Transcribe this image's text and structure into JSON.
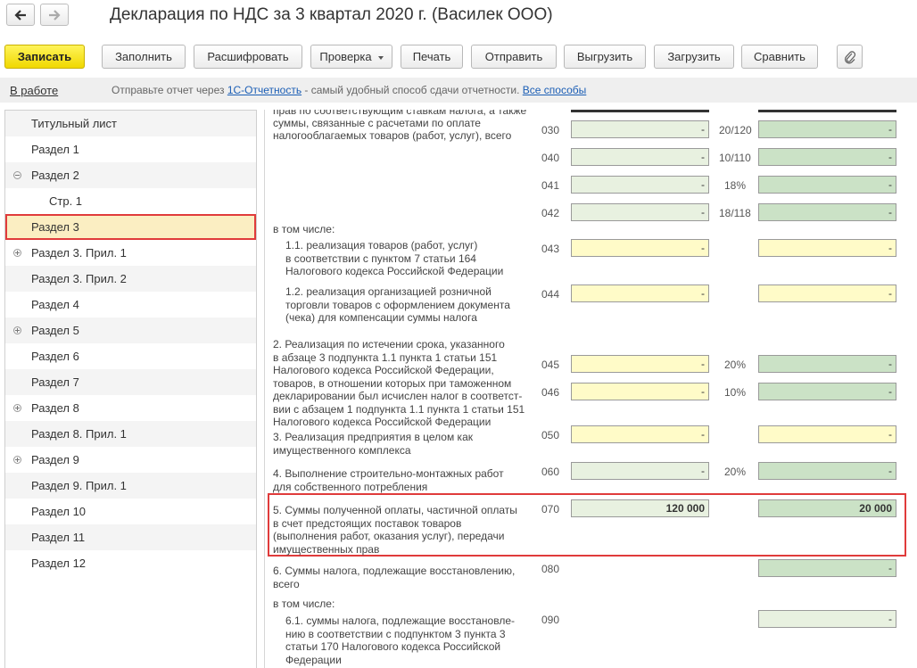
{
  "window": {
    "title": "Декларация по НДС за 3 квартал 2020 г. (Василек ООО)"
  },
  "toolbar": {
    "save": "Записать",
    "fill": "Заполнить",
    "decode": "Расшифровать",
    "check": "Проверка",
    "print": "Печать",
    "send": "Отправить",
    "export": "Выгрузить",
    "import": "Загрузить",
    "compare": "Сравнить"
  },
  "status": {
    "state": "В работе",
    "msg_prefix": "Отправьте отчет через ",
    "msg_link": "1С-Отчетность",
    "msg_middle": " - самый удобный способ сдачи отчетности. ",
    "msg_link2": "Все способы"
  },
  "sidebar": {
    "items": [
      {
        "label": "Титульный лист"
      },
      {
        "label": "Раздел 1"
      },
      {
        "label": "Раздел 2"
      },
      {
        "label": "Стр. 1"
      },
      {
        "label": "Раздел 3"
      },
      {
        "label": "Раздел 3. Прил. 1"
      },
      {
        "label": "Раздел 3. Прил. 2"
      },
      {
        "label": "Раздел 4"
      },
      {
        "label": "Раздел 5"
      },
      {
        "label": "Раздел 6"
      },
      {
        "label": "Раздел 7"
      },
      {
        "label": "Раздел 8"
      },
      {
        "label": "Раздел 8. Прил. 1"
      },
      {
        "label": "Раздел 9"
      },
      {
        "label": "Раздел 9. Прил. 1"
      },
      {
        "label": "Раздел 10"
      },
      {
        "label": "Раздел 11"
      },
      {
        "label": "Раздел 12"
      }
    ]
  },
  "form": {
    "top_text": [
      "прав по соответствующим ставкам налога, а также",
      "суммы, связанные с расчетами по оплате",
      "налогооблагаемых товаров (работ, услуг), всего"
    ],
    "rows": {
      "r030": {
        "code": "030",
        "rate": "20/120",
        "base": "-",
        "tax": "-"
      },
      "r040": {
        "code": "040",
        "rate": "10/110",
        "base": "-",
        "tax": "-"
      },
      "r041": {
        "code": "041",
        "rate": "18%",
        "base": "-",
        "tax": "-"
      },
      "r042": {
        "code": "042",
        "rate": "18/118",
        "base": "-",
        "tax": "-"
      },
      "including": "в том числе:",
      "r043": {
        "code": "043",
        "base": "-",
        "tax": "-",
        "text": [
          "1.1. реализация товаров (работ, услуг)",
          "в соответствии с пунктом 7 статьи 164",
          "Налогового кодекса Российской Федерации"
        ]
      },
      "r044": {
        "code": "044",
        "base": "-",
        "tax": "-",
        "text": [
          "1.2. реализация организацией розничной",
          "торговли товаров с оформлением документа",
          "(чека) для компенсации суммы налога"
        ]
      },
      "sec2_text": [
        "2. Реализация по истечении срока, указанного",
        "в абзаце 3 подпункта 1.1 пункта 1 статьи 151",
        "Налогового кодекса Российской Федерации,",
        "товаров, в отношении которых при таможенном",
        "декларировании был исчислен налог в соответст-",
        "вии с абзацем 1 подпункта 1.1 пункта 1 статьи 151",
        "Налогового кодекса Российской Федерации"
      ],
      "r045": {
        "code": "045",
        "rate": "20%",
        "base": "-",
        "tax": "-"
      },
      "r046": {
        "code": "046",
        "rate": "10%",
        "base": "-",
        "tax": "-"
      },
      "r050": {
        "code": "050",
        "base": "-",
        "tax": "-",
        "text": [
          "3. Реализация предприятия в целом как",
          "имущественного комплекса"
        ]
      },
      "r060": {
        "code": "060",
        "rate": "20%",
        "base": "-",
        "tax": "-",
        "text": [
          "4. Выполнение строительно-монтажных работ",
          "для собственного потребления"
        ]
      },
      "r070": {
        "code": "070",
        "base": "120 000",
        "tax": "20 000",
        "text": [
          "5. Суммы полученной оплаты, частичной оплаты",
          "в счет предстоящих поставок товаров",
          "(выполнения работ, оказания услуг), передачи",
          "имущественных прав"
        ]
      },
      "r080": {
        "code": "080",
        "tax": "-",
        "text": [
          "6. Суммы налога, подлежащие восстановлению,",
          "всего"
        ]
      },
      "including2": "в том числе:",
      "r090": {
        "code": "090",
        "tax": "-",
        "text": [
          "6.1. суммы налога, подлежащие восстановле-",
          "нию в соответствии с подпунктом 3 пункта 3",
          "статьи 170 Налогового кодекса Российской",
          "Федерации"
        ]
      }
    }
  },
  "colors": {
    "accent_yellow": "#f0d800",
    "highlight_red": "#e03b3b",
    "field_light_green": "#e8f1e0",
    "field_dark_green": "#cbe2c6",
    "field_yellow": "#fffbc8",
    "selected_row": "#fbeec2"
  },
  "icons": [
    "arrow-left-icon",
    "arrow-right-icon",
    "paperclip-icon",
    "plus-expander-icon",
    "minus-expander-icon"
  ]
}
